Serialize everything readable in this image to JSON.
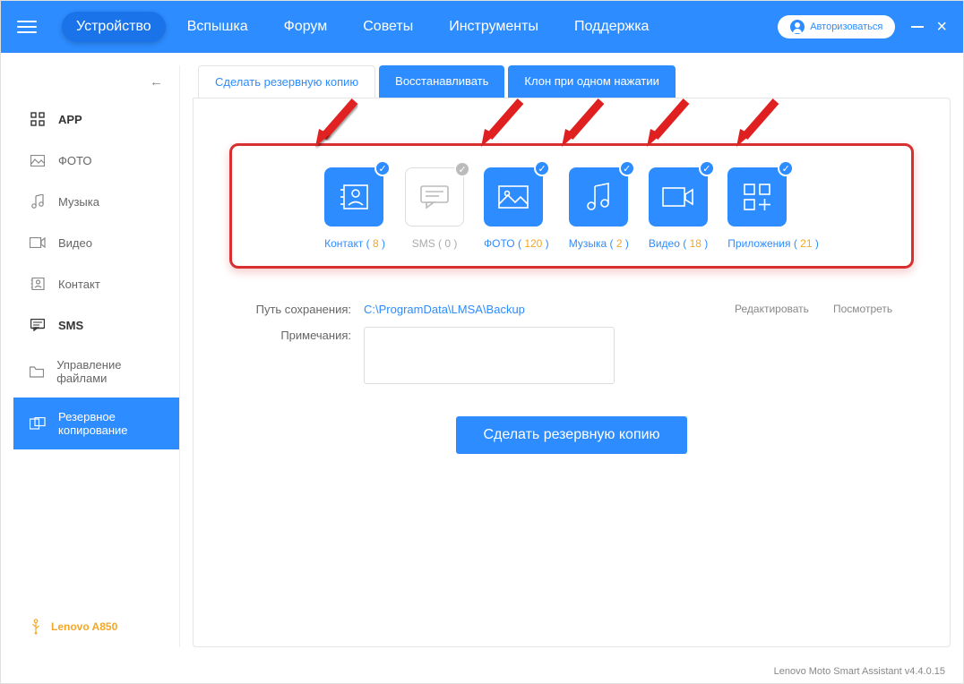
{
  "header": {
    "nav": [
      "Устройство",
      "Вспышка",
      "Форум",
      "Советы",
      "Инструменты",
      "Поддержка"
    ],
    "auth_label": "Авторизоваться"
  },
  "sidebar": {
    "items": [
      {
        "label": "APP",
        "bold": true
      },
      {
        "label": "ФОТО",
        "bold": false
      },
      {
        "label": "Музыка",
        "bold": false
      },
      {
        "label": "Видео",
        "bold": false
      },
      {
        "label": "Контакт",
        "bold": false
      },
      {
        "label": "SMS",
        "bold": true
      },
      {
        "label": "Управление файлами",
        "bold": false
      },
      {
        "label": "Резервное копирование",
        "bold": false,
        "active": true
      }
    ],
    "device": "Lenovo A850"
  },
  "tabs": [
    "Сделать резервную копию",
    "Восстанавливать",
    "Клон при одном нажатии"
  ],
  "cards": [
    {
      "name": "Контакт",
      "count": 8,
      "selected": true
    },
    {
      "name": "SMS",
      "count": 0,
      "selected": false
    },
    {
      "name": "ФОТО",
      "count": 120,
      "selected": true
    },
    {
      "name": "Музыка",
      "count": 2,
      "selected": true
    },
    {
      "name": "Видео",
      "count": 18,
      "selected": true
    },
    {
      "name": "Приложения",
      "count": 21,
      "selected": true
    }
  ],
  "form": {
    "path_label": "Путь сохранения:",
    "path_value": "C:\\ProgramData\\LMSA\\Backup",
    "notes_label": "Примечания:",
    "edit_label": "Редактировать",
    "view_label": "Посмотреть",
    "action_label": "Сделать резервную копию"
  },
  "footer": "Lenovo Moto Smart Assistant v4.4.0.15"
}
